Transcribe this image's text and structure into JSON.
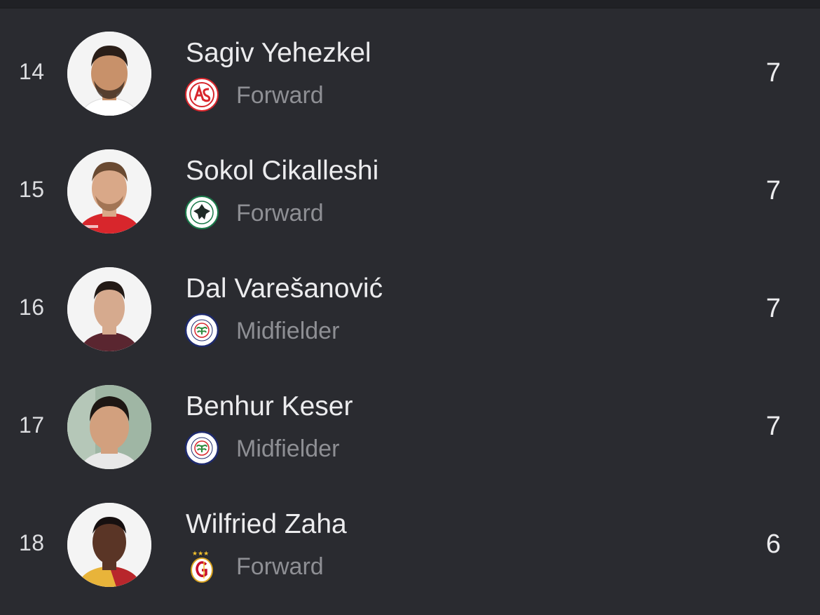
{
  "players": [
    {
      "rank": "14",
      "name": "Sagiv Yehezkel",
      "position": "Forward",
      "value": "7",
      "club_icon": "antalyaspor-logo-icon",
      "avatar_icon": "player-photo-icon",
      "shirt_color": "#ffffff",
      "skin_color": "#c8916a",
      "hair_color": "#2a1e18"
    },
    {
      "rank": "15",
      "name": "Sokol Cikalleshi",
      "position": "Forward",
      "value": "7",
      "club_icon": "konyaspor-logo-icon",
      "avatar_icon": "player-photo-icon",
      "shirt_color": "#d8262c",
      "skin_color": "#d9a888",
      "hair_color": "#6a4a32"
    },
    {
      "rank": "16",
      "name": "Dal Varešanović",
      "position": "Midfielder",
      "value": "7",
      "club_icon": "rizespor-logo-icon",
      "avatar_icon": "player-photo-icon",
      "shirt_color": "#5a2630",
      "skin_color": "#d6aa8e",
      "hair_color": "#231a16"
    },
    {
      "rank": "17",
      "name": "Benhur Keser",
      "position": "Midfielder",
      "value": "7",
      "club_icon": "rizespor-logo-icon",
      "avatar_icon": "player-photo-icon",
      "shirt_color": "#e8e8e8",
      "skin_color": "#d2a07e",
      "hair_color": "#1e1714"
    },
    {
      "rank": "18",
      "name": "Wilfried Zaha",
      "position": "Forward",
      "value": "6",
      "club_icon": "galatasaray-logo-icon",
      "avatar_icon": "player-photo-icon",
      "shirt_color": "#e8b43a",
      "skin_color": "#5a3526",
      "hair_color": "#161010"
    }
  ]
}
